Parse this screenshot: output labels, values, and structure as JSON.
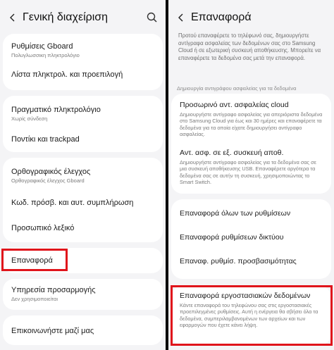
{
  "left": {
    "title": "Γενική διαχείριση",
    "items": [
      {
        "label": "Ρυθμίσεις Gboard",
        "sub": "Πολυγλωσσικη πληκτρολόγιο"
      },
      {
        "label": "Λίστα πληκτρολ. και προεπιλογή"
      },
      {
        "label": "Πραγματικό πληκτρολόγιο",
        "sub": "Χωρίς σύνδεση"
      },
      {
        "label": "Ποντίκι και trackpad"
      },
      {
        "label": "Ορθογραφικός έλεγχος",
        "sub": "Ορθογραφικός έλεγχος Gboard"
      },
      {
        "label": "Κωδ. πρόσβ. και αυτ. συμπλήρωση"
      },
      {
        "label": "Προσωπικό λεξικό"
      },
      {
        "label": "Επαναφορά"
      },
      {
        "label": "Υπηρεσία προσαρμογής",
        "sub": "Δεν χρησιμοποιείται"
      },
      {
        "label": "Επικοινωνήστε μαζί μας"
      }
    ]
  },
  "right": {
    "title": "Επαναφορά",
    "intro": "Προτού επαναφέρετε το τηλέφωνό σας, δημιουργήστε αντίγραφα ασφαλείας των δεδομένων σας στο Samsung Cloud ή σε εξωτερική συσκευή αποθήκευσης. Μπορείτε να επαναφέρετε τα δεδομένα σας μετά την επαναφορά.",
    "backup_section": "Δημιουργία αντιγράφου ασφαλείας για τα δεδομένα",
    "cloud_title": "Προσωρινό αντ. ασφαλείας cloud",
    "cloud_desc": "Δημιουργήστε αντίγραφο ασφαλείας για απεριόριστα δεδομένα στο Samsung Cloud για έως και 30 ημέρες και επαναφέρετε τα δεδομένα για τα οποία είχατε δημιουργήσει αντίγραφο ασφαλείας.",
    "ext_title": "Αντ. ασφ. σε εξ. συσκευή αποθ.",
    "ext_desc": "Δημιουργήστε αντίγραφο ασφαλείας για τα δεδομένα σας σε μια συσκευή αποθήκευσης USB. Επαναφέρετε αργότερα τα δεδομένα σας σε αυτήν τη συσκευή, χρησιμοποιώντας το Smart Switch.",
    "reset_all": "Επαναφορά όλων των ρυθμίσεων",
    "reset_network": "Επαναφορά ρυθμίσεων δικτύου",
    "reset_access": "Επαναφ. ρυθμίσ. προσβασιμότητας",
    "factory_title": "Επαναφορά εργοστασιακών δεδομένων",
    "factory_desc": "Κάντε επαναφορά του τηλεφώνου σας στις εργοστασιακές προεπιλεγμένες ρυθμίσεις. Αυτή η ενέργεια θα σβήσει όλα τα δεδομένα, συμπεριλαμβανομένων των αρχείων και των εφαρμογών που έχετε κάνει λήψη."
  },
  "colors": {
    "highlight": "#e0141b",
    "background": "#f4f4f6",
    "card": "#ffffff"
  },
  "icons": [
    "back-arrow-icon",
    "search-icon"
  ]
}
